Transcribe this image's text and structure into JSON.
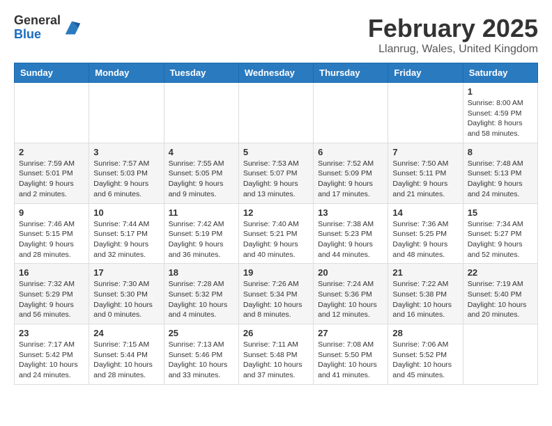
{
  "header": {
    "logo_line1": "General",
    "logo_line2": "Blue",
    "month_title": "February 2025",
    "location": "Llanrug, Wales, United Kingdom"
  },
  "days_of_week": [
    "Sunday",
    "Monday",
    "Tuesday",
    "Wednesday",
    "Thursday",
    "Friday",
    "Saturday"
  ],
  "weeks": [
    [
      {
        "day": "",
        "info": ""
      },
      {
        "day": "",
        "info": ""
      },
      {
        "day": "",
        "info": ""
      },
      {
        "day": "",
        "info": ""
      },
      {
        "day": "",
        "info": ""
      },
      {
        "day": "",
        "info": ""
      },
      {
        "day": "1",
        "info": "Sunrise: 8:00 AM\nSunset: 4:59 PM\nDaylight: 8 hours and 58 minutes."
      }
    ],
    [
      {
        "day": "2",
        "info": "Sunrise: 7:59 AM\nSunset: 5:01 PM\nDaylight: 9 hours and 2 minutes."
      },
      {
        "day": "3",
        "info": "Sunrise: 7:57 AM\nSunset: 5:03 PM\nDaylight: 9 hours and 6 minutes."
      },
      {
        "day": "4",
        "info": "Sunrise: 7:55 AM\nSunset: 5:05 PM\nDaylight: 9 hours and 9 minutes."
      },
      {
        "day": "5",
        "info": "Sunrise: 7:53 AM\nSunset: 5:07 PM\nDaylight: 9 hours and 13 minutes."
      },
      {
        "day": "6",
        "info": "Sunrise: 7:52 AM\nSunset: 5:09 PM\nDaylight: 9 hours and 17 minutes."
      },
      {
        "day": "7",
        "info": "Sunrise: 7:50 AM\nSunset: 5:11 PM\nDaylight: 9 hours and 21 minutes."
      },
      {
        "day": "8",
        "info": "Sunrise: 7:48 AM\nSunset: 5:13 PM\nDaylight: 9 hours and 24 minutes."
      }
    ],
    [
      {
        "day": "9",
        "info": "Sunrise: 7:46 AM\nSunset: 5:15 PM\nDaylight: 9 hours and 28 minutes."
      },
      {
        "day": "10",
        "info": "Sunrise: 7:44 AM\nSunset: 5:17 PM\nDaylight: 9 hours and 32 minutes."
      },
      {
        "day": "11",
        "info": "Sunrise: 7:42 AM\nSunset: 5:19 PM\nDaylight: 9 hours and 36 minutes."
      },
      {
        "day": "12",
        "info": "Sunrise: 7:40 AM\nSunset: 5:21 PM\nDaylight: 9 hours and 40 minutes."
      },
      {
        "day": "13",
        "info": "Sunrise: 7:38 AM\nSunset: 5:23 PM\nDaylight: 9 hours and 44 minutes."
      },
      {
        "day": "14",
        "info": "Sunrise: 7:36 AM\nSunset: 5:25 PM\nDaylight: 9 hours and 48 minutes."
      },
      {
        "day": "15",
        "info": "Sunrise: 7:34 AM\nSunset: 5:27 PM\nDaylight: 9 hours and 52 minutes."
      }
    ],
    [
      {
        "day": "16",
        "info": "Sunrise: 7:32 AM\nSunset: 5:29 PM\nDaylight: 9 hours and 56 minutes."
      },
      {
        "day": "17",
        "info": "Sunrise: 7:30 AM\nSunset: 5:30 PM\nDaylight: 10 hours and 0 minutes."
      },
      {
        "day": "18",
        "info": "Sunrise: 7:28 AM\nSunset: 5:32 PM\nDaylight: 10 hours and 4 minutes."
      },
      {
        "day": "19",
        "info": "Sunrise: 7:26 AM\nSunset: 5:34 PM\nDaylight: 10 hours and 8 minutes."
      },
      {
        "day": "20",
        "info": "Sunrise: 7:24 AM\nSunset: 5:36 PM\nDaylight: 10 hours and 12 minutes."
      },
      {
        "day": "21",
        "info": "Sunrise: 7:22 AM\nSunset: 5:38 PM\nDaylight: 10 hours and 16 minutes."
      },
      {
        "day": "22",
        "info": "Sunrise: 7:19 AM\nSunset: 5:40 PM\nDaylight: 10 hours and 20 minutes."
      }
    ],
    [
      {
        "day": "23",
        "info": "Sunrise: 7:17 AM\nSunset: 5:42 PM\nDaylight: 10 hours and 24 minutes."
      },
      {
        "day": "24",
        "info": "Sunrise: 7:15 AM\nSunset: 5:44 PM\nDaylight: 10 hours and 28 minutes."
      },
      {
        "day": "25",
        "info": "Sunrise: 7:13 AM\nSunset: 5:46 PM\nDaylight: 10 hours and 33 minutes."
      },
      {
        "day": "26",
        "info": "Sunrise: 7:11 AM\nSunset: 5:48 PM\nDaylight: 10 hours and 37 minutes."
      },
      {
        "day": "27",
        "info": "Sunrise: 7:08 AM\nSunset: 5:50 PM\nDaylight: 10 hours and 41 minutes."
      },
      {
        "day": "28",
        "info": "Sunrise: 7:06 AM\nSunset: 5:52 PM\nDaylight: 10 hours and 45 minutes."
      },
      {
        "day": "",
        "info": ""
      }
    ]
  ]
}
